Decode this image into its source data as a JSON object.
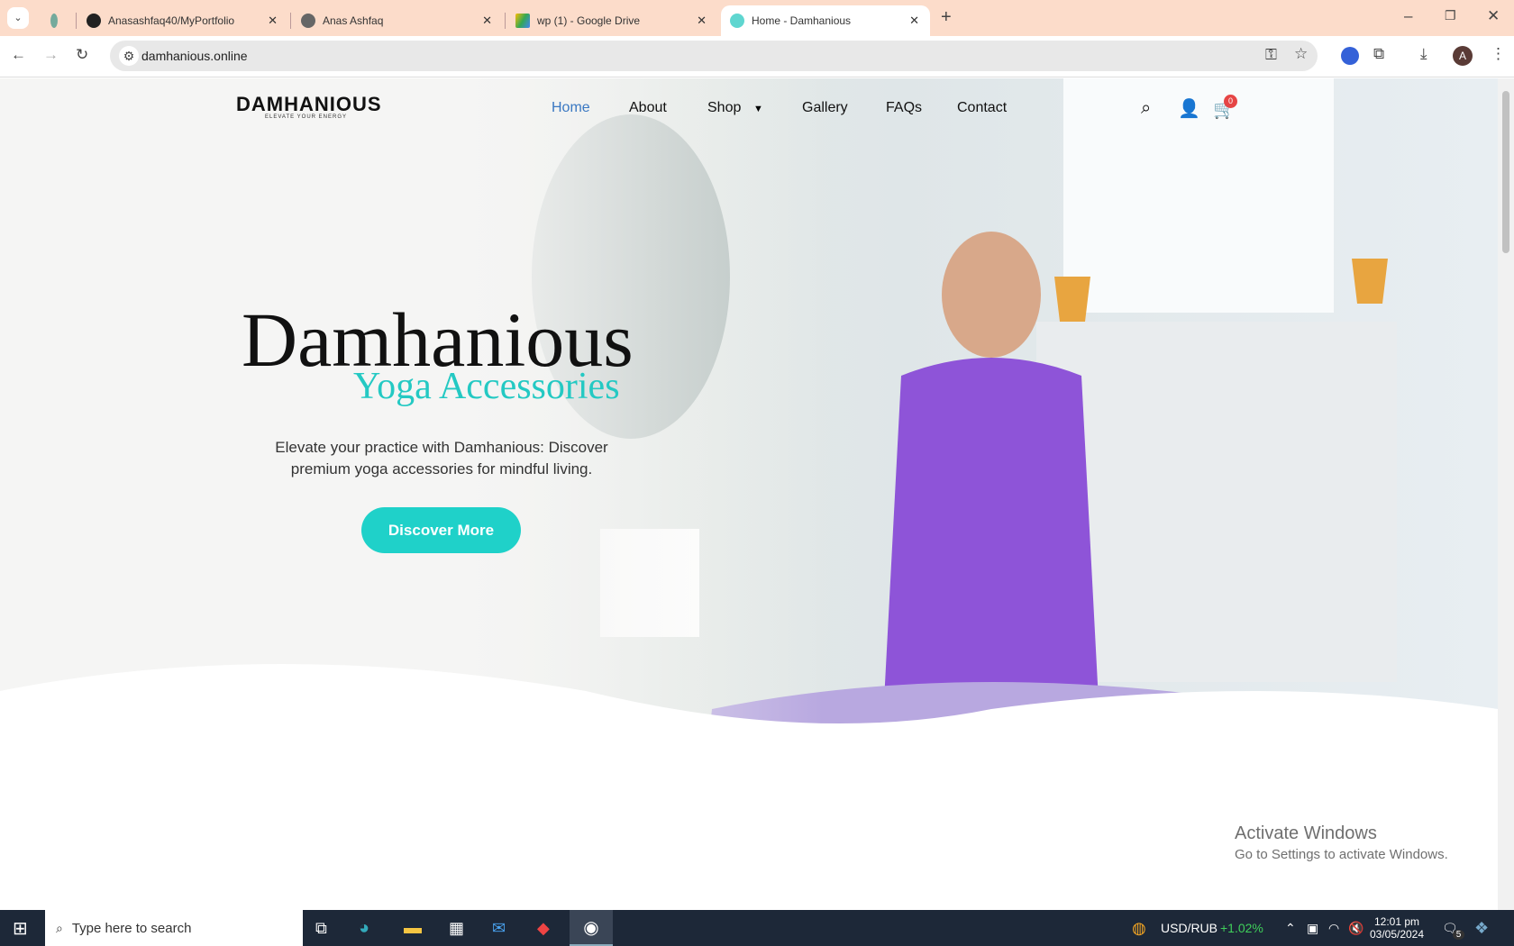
{
  "browser": {
    "tabs": [
      {
        "label": "Anasashfaq40/MyPortfolio"
      },
      {
        "label": "Anas Ashfaq"
      },
      {
        "label": "wp (1) - Google Drive"
      },
      {
        "label": "Home - Damhanious"
      }
    ],
    "url": "damhanious.online",
    "profile_initial": "A"
  },
  "site": {
    "logo": "DAMHANIOUS",
    "logo_tagline": "ELEVATE YOUR ENERGY",
    "nav": [
      "Home",
      "About",
      "Shop",
      "Gallery",
      "FAQs",
      "Contact"
    ],
    "cart_count": "0",
    "hero": {
      "title": "Damhanious",
      "subtitle": "Yoga Accessories",
      "text": "Elevate your practice with Damhanious: Discover premium yoga accessories for mindful living.",
      "button": "Discover More"
    }
  },
  "watermark": {
    "title": "Activate Windows",
    "text": "Go to Settings to activate Windows."
  },
  "taskbar": {
    "search_placeholder": "Type here to search",
    "ticker": "USD/RUB",
    "change": "+1.02%",
    "time": "12:01 pm",
    "date": "03/05/2024",
    "notifications": "5"
  },
  "colors": {
    "accent": "#1fd1c9",
    "active_nav": "#3a78c2",
    "tabbar": "#fcdcca"
  }
}
